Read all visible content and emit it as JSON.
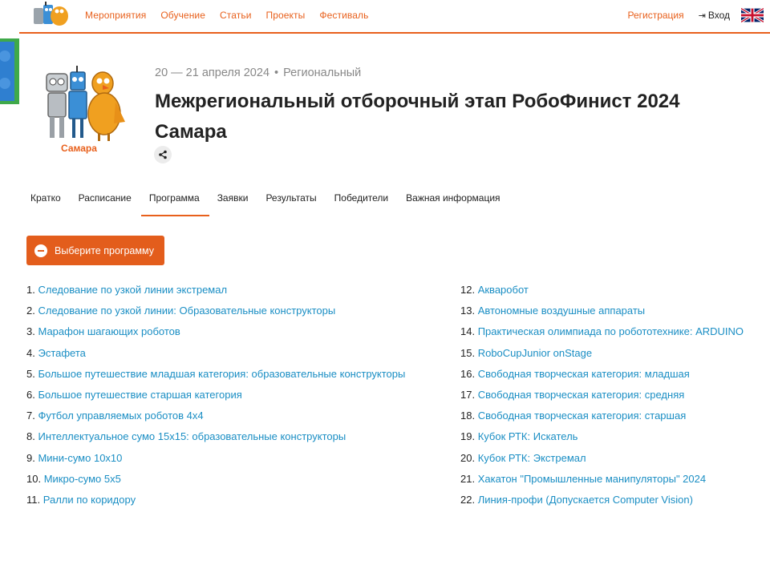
{
  "nav": {
    "menu": [
      "Мероприятия",
      "Обучение",
      "Статьи",
      "Проекты",
      "Фестиваль"
    ],
    "register": "Регистрация",
    "login": "Вход"
  },
  "event": {
    "date": "20 — 21 апреля 2024",
    "type": "Региональный",
    "title": "Межрегиональный отборочный этап РобоФинист 2024 Самара",
    "logo_caption": "Самара"
  },
  "tabs": [
    "Кратко",
    "Расписание",
    "Программа",
    "Заявки",
    "Результаты",
    "Победители",
    "Важная информация"
  ],
  "active_tab": "Программа",
  "program_button": "Выберите программу",
  "programs_left": [
    {
      "num": "1.",
      "title": "Следование по узкой линии экстремал"
    },
    {
      "num": "2.",
      "title": "Следование по узкой линии: Образовательные конструкторы"
    },
    {
      "num": "3.",
      "title": "Марафон шагающих роботов"
    },
    {
      "num": "4.",
      "title": "Эстафета"
    },
    {
      "num": "5.",
      "title": "Большое путешествие младшая категория: образовательные конструкторы"
    },
    {
      "num": "6.",
      "title": "Большое путешествие старшая категория"
    },
    {
      "num": "7.",
      "title": "Футбол управляемых роботов 4х4"
    },
    {
      "num": "8.",
      "title": "Интеллектуальное сумо 15х15: образовательные конструкторы"
    },
    {
      "num": "9.",
      "title": "Мини-сумо 10х10"
    },
    {
      "num": "10.",
      "title": "Микро-сумо 5х5"
    },
    {
      "num": "11.",
      "title": "Ралли по коридору"
    }
  ],
  "programs_right": [
    {
      "num": "12.",
      "title": "Акваробот"
    },
    {
      "num": "13.",
      "title": "Автономные воздушные аппараты"
    },
    {
      "num": "14.",
      "title": "Практическая олимпиада по робототехнике: ARDUINO"
    },
    {
      "num": "15.",
      "title": "RoboCupJunior onStage"
    },
    {
      "num": "16.",
      "title": "Свободная творческая категория: младшая"
    },
    {
      "num": "17.",
      "title": "Свободная творческая категория: средняя"
    },
    {
      "num": "18.",
      "title": "Свободная творческая категория: старшая"
    },
    {
      "num": "19.",
      "title": "Кубок РТК: Искатель"
    },
    {
      "num": "20.",
      "title": "Кубок РТК: Экстремал"
    },
    {
      "num": "21.",
      "title": "Хакатон \"Промышленные манипуляторы\" 2024"
    },
    {
      "num": "22.",
      "title": "Линия-профи (Допускается Computer Vision)"
    }
  ],
  "colors": {
    "accent": "#e8601c",
    "link": "#1a8ec4"
  }
}
